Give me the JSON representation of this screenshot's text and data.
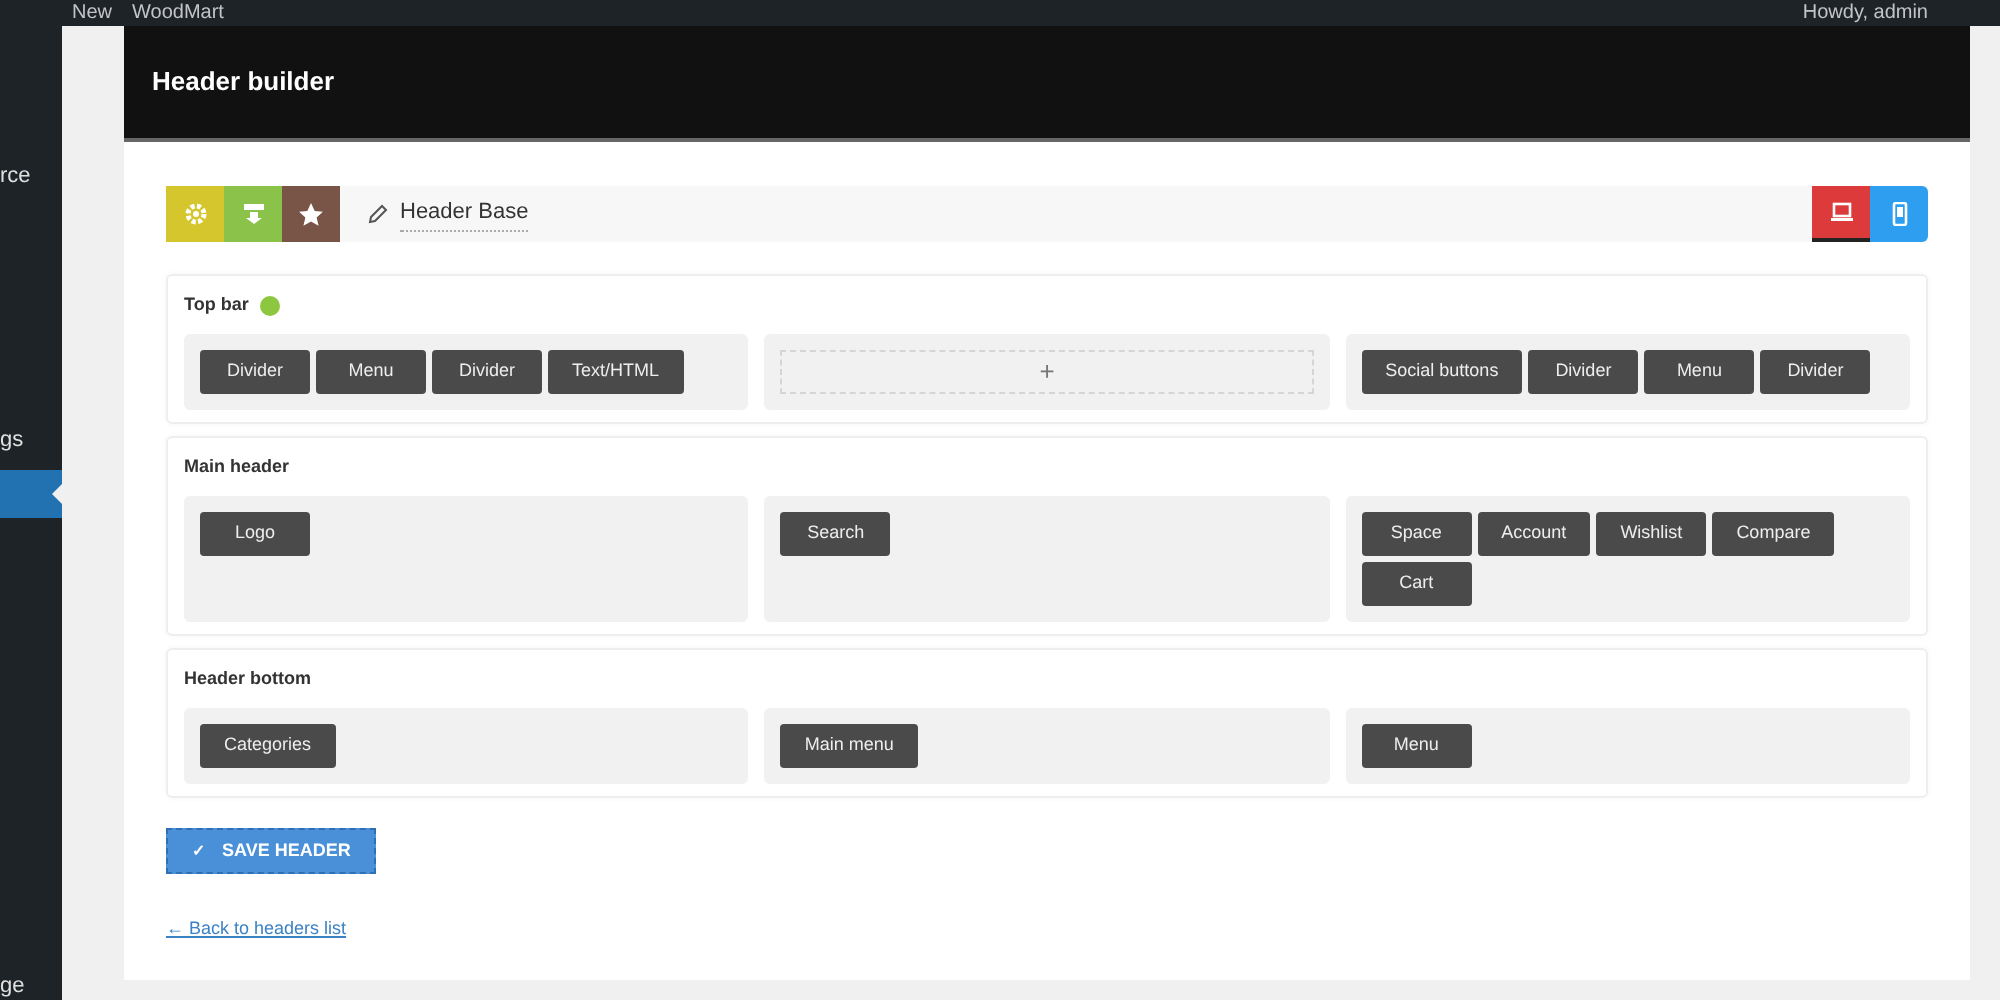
{
  "admin_bar": {
    "items": [
      "New",
      "WoodMart"
    ],
    "greeting": "Howdy, admin"
  },
  "sidebar": {
    "items": [
      {
        "label": "rce",
        "selected": false
      },
      {
        "label": "gs",
        "selected": false
      },
      {
        "selected": true
      },
      {
        "label": "ge",
        "selected": false
      }
    ]
  },
  "page_title": "Header builder",
  "toolbar": {
    "actions": [
      {
        "kind": "settings",
        "color": "#d4c62c"
      },
      {
        "kind": "import",
        "color": "#8bc34a"
      },
      {
        "kind": "star",
        "color": "#795548"
      }
    ],
    "header_name": "Header Base",
    "devices": [
      {
        "kind": "desktop",
        "color": "#dd3b3b",
        "selected": true
      },
      {
        "kind": "mobile",
        "color": "#2e9ef0",
        "selected": false
      }
    ]
  },
  "sections": [
    {
      "title": "Top bar",
      "indicator": true,
      "columns": [
        {
          "kind": "elements",
          "elements": [
            "Divider",
            "Menu",
            "Divider",
            "Text/HTML"
          ]
        },
        {
          "kind": "empty",
          "add": "+"
        },
        {
          "kind": "elements",
          "elements": [
            "Social buttons",
            "Divider",
            "Menu",
            "Divider"
          ]
        }
      ]
    },
    {
      "title": "Main header",
      "indicator": false,
      "columns": [
        {
          "kind": "elements",
          "elements": [
            "Logo"
          ]
        },
        {
          "kind": "elements",
          "elements": [
            "Search"
          ]
        },
        {
          "kind": "elements",
          "elements": [
            "Space",
            "Account",
            "Wishlist",
            "Compare",
            "Cart"
          ]
        }
      ]
    },
    {
      "title": "Header bottom",
      "indicator": false,
      "columns": [
        {
          "kind": "elements",
          "elements": [
            "Categories"
          ]
        },
        {
          "kind": "elements",
          "elements": [
            "Main menu"
          ]
        },
        {
          "kind": "elements",
          "elements": [
            "Menu"
          ]
        }
      ]
    }
  ],
  "save_button": {
    "icon": "✓",
    "label": "SAVE HEADER"
  },
  "back_link": "← Back to headers list"
}
